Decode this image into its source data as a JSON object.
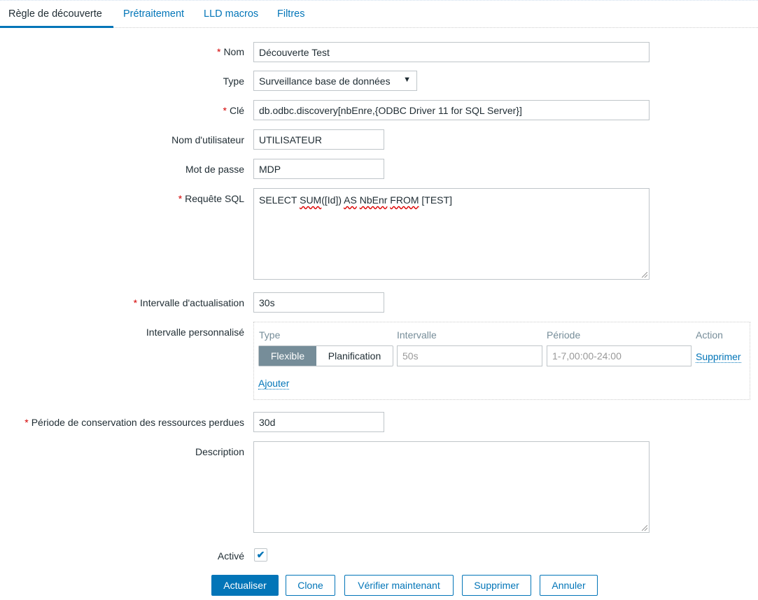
{
  "tabs": [
    "Règle de découverte",
    "Prétraitement",
    "LLD macros",
    "Filtres"
  ],
  "form": {
    "name_label": "Nom",
    "name_value": "Découverte Test",
    "type_label": "Type",
    "type_value": "Surveillance base de données",
    "key_label": "Clé",
    "key_value": "db.odbc.discovery[nbEnre,{ODBC Driver 11 for SQL Server}]",
    "user_label": "Nom d'utilisateur",
    "user_value": "UTILISATEUR",
    "pass_label": "Mot de passe",
    "pass_value": "MDP",
    "sql_label": "Requête SQL",
    "sql_parts": [
      "SELECT ",
      "SUM",
      "([Id]) ",
      "AS",
      " ",
      "NbEnr",
      " ",
      "FROM",
      " [TEST]"
    ],
    "interval_label": "Intervalle d'actualisation",
    "interval_value": "30s",
    "custom_label": "Intervalle personnalisé",
    "custom": {
      "h_type": "Type",
      "h_interval": "Intervalle",
      "h_period": "Période",
      "h_action": "Action",
      "flexible": "Flexible",
      "scheduling": "Planification",
      "interval_placeholder": "50s",
      "period_placeholder": "1-7,00:00-24:00",
      "remove": "Supprimer",
      "add": "Ajouter"
    },
    "keep_label": "Période de conservation des ressources perdues",
    "keep_value": "30d",
    "desc_label": "Description",
    "desc_value": "",
    "enabled_label": "Activé",
    "enabled": true
  },
  "buttons": [
    "Actualiser",
    "Clone",
    "Vérifier maintenant",
    "Supprimer",
    "Annuler"
  ]
}
